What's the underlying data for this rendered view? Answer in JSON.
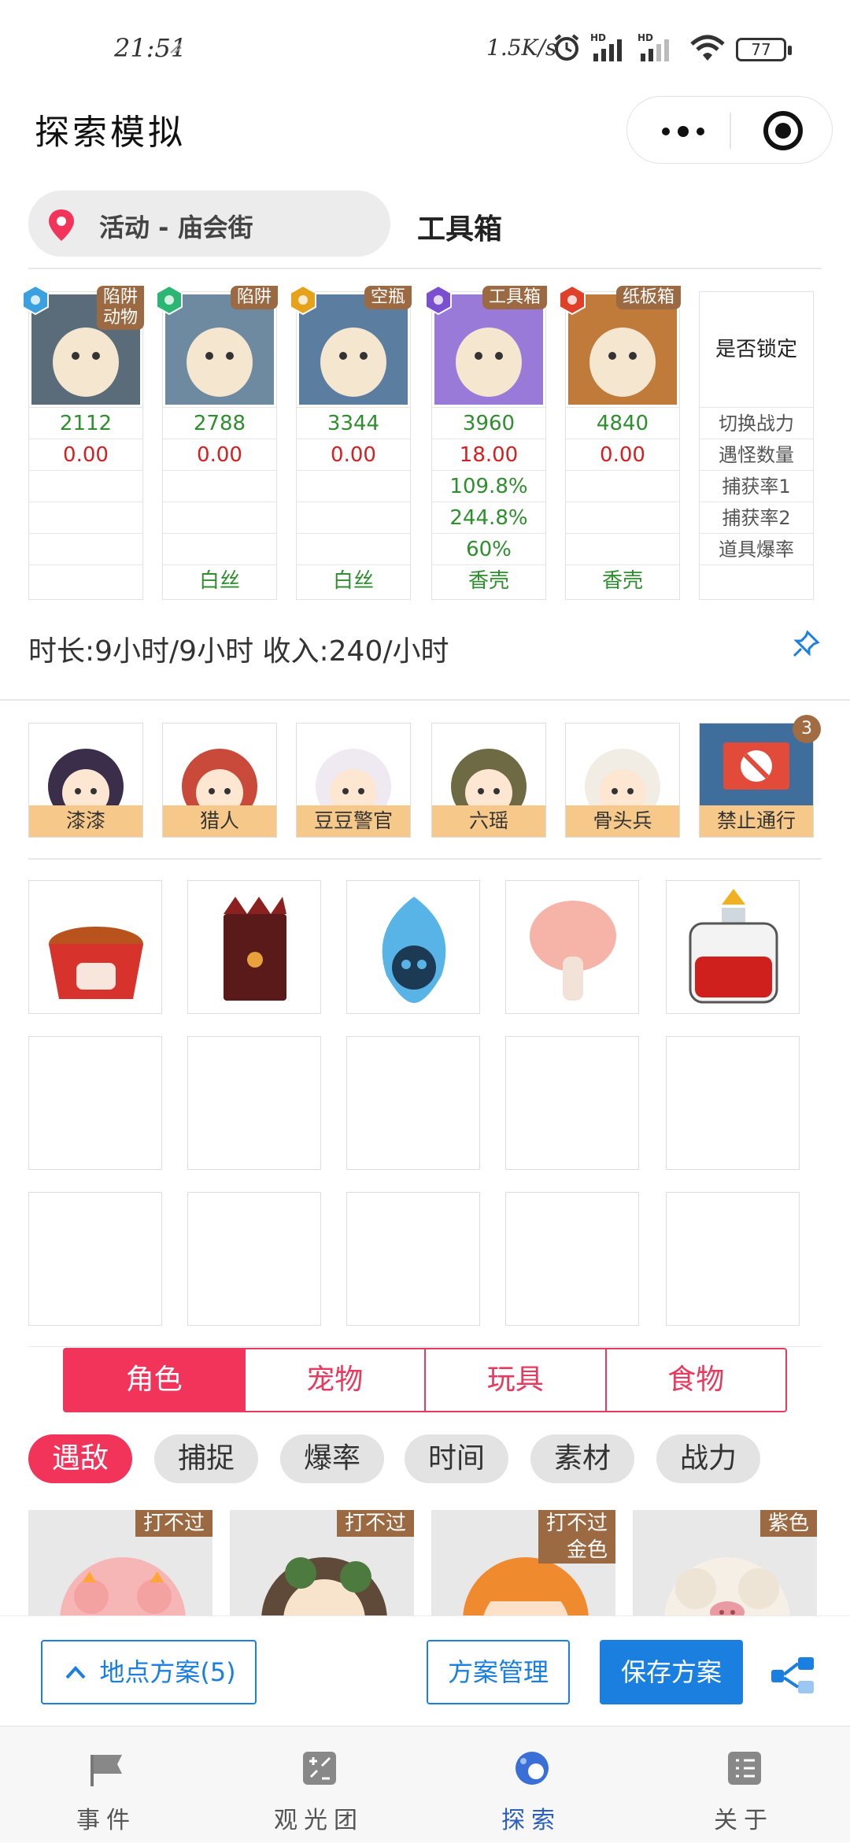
{
  "status_bar": {
    "time": "21:51",
    "net_speed": "1.5K/s",
    "battery": "77"
  },
  "header": {
    "title": "探索模拟"
  },
  "location": {
    "label": "活动 - 庙会街",
    "current_tool": "工具箱"
  },
  "stat_columns": [
    {
      "tag": "陷阱\n动物",
      "power": "2112",
      "monsters": "0.00",
      "capture1": "",
      "capture2": "",
      "drop": "",
      "material": "",
      "hex_color": "#3aa0e0"
    },
    {
      "tag": "陷阱",
      "power": "2788",
      "monsters": "0.00",
      "capture1": "",
      "capture2": "",
      "drop": "",
      "material": "白丝",
      "hex_color": "#2bb673"
    },
    {
      "tag": "空瓶",
      "power": "3344",
      "monsters": "0.00",
      "capture1": "",
      "capture2": "",
      "drop": "",
      "material": "白丝",
      "hex_color": "#e6a21a"
    },
    {
      "tag": "工具箱",
      "power": "3960",
      "monsters": "18.00",
      "capture1": "109.8%",
      "capture2": "244.8%",
      "drop": "60%",
      "material": "香壳",
      "hex_color": "#7a4fd0"
    },
    {
      "tag": "纸板箱",
      "power": "4840",
      "monsters": "0.00",
      "capture1": "",
      "capture2": "",
      "drop": "",
      "material": "香壳",
      "hex_color": "#e0402a"
    }
  ],
  "lock_column": {
    "head": "是否锁定",
    "rows": [
      "切换战力",
      "遇怪数量",
      "捕获率1",
      "捕获率2",
      "道具爆率"
    ]
  },
  "summary": "时长:9小时/9小时 收入:240/小时",
  "characters": [
    {
      "name": "漆漆"
    },
    {
      "name": "猎人"
    },
    {
      "name": "豆豆警官"
    },
    {
      "name": "六瑶"
    },
    {
      "name": "骨头兵"
    },
    {
      "name": "禁止通行",
      "badge": "3"
    }
  ],
  "items": [
    "fried-chicken-bucket",
    "red-box",
    "blue-skull-flame",
    "pink-mushroom",
    "red-potion"
  ],
  "tabs": [
    "角色",
    "宠物",
    "玩具",
    "食物"
  ],
  "filters": [
    "遇敌",
    "捕捉",
    "爆率",
    "时间",
    "素材",
    "战力"
  ],
  "cards": [
    {
      "tag": "打不过"
    },
    {
      "tag": "打不过"
    },
    {
      "tag": "打不过\n金色"
    },
    {
      "tag": "紫色"
    }
  ],
  "actions": {
    "location_plan": "地点方案(5)",
    "manage": "方案管理",
    "save": "保存方案"
  },
  "nav": [
    "事件",
    "观光团",
    "探索",
    "关于"
  ],
  "colors": {
    "accent_red": "#f2345a",
    "accent_blue": "#1b7fe0",
    "green": "#2f8f2f",
    "red": "#d62020",
    "tag_brown": "#9c6a42"
  }
}
